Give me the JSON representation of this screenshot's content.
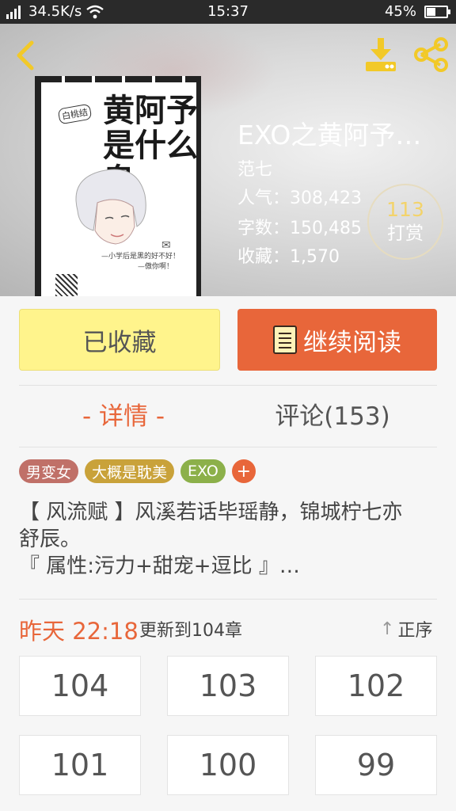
{
  "status_bar": {
    "network_speed": "34.5K/s",
    "time": "15:37",
    "battery": "45%",
    "battery_level": 0.45
  },
  "book": {
    "title": "EXO之黄阿予…",
    "author": "范七",
    "popularity": "人气：308,423",
    "word_count": "字数：150,485",
    "favorites": "收藏：1,570",
    "tip_count": "113",
    "tip_label": "打赏",
    "cover": {
      "title_line1": "黄阿予",
      "title_line2": "是什么鬼",
      "tag": "白桃结",
      "quote_line1": "—小学后是黑的好不好！",
      "quote_line2": "—傲你啊！"
    }
  },
  "actions": {
    "favorite_label": "已收藏",
    "read_label": "继续阅读"
  },
  "tabs": {
    "detail": "- 详情 -",
    "comments": "评论(153)"
  },
  "tags": [
    {
      "label": "男变女",
      "color": "#c07068"
    },
    {
      "label": "大概是耽美",
      "color": "#c9a23a"
    },
    {
      "label": "EXO",
      "color": "#8cb04a"
    }
  ],
  "tag_add": "+",
  "summary": {
    "line1": "【 风流赋 】风溪若话毕瑶静，锦城柠七亦",
    "line2": "舒辰。",
    "line3": "『 属性:污力+甜宠+逗比 』…"
  },
  "update": {
    "time": "昨天 22:18",
    "text": "更新到104章",
    "sort_label": "正序"
  },
  "chapters": [
    "104",
    "103",
    "102",
    "101",
    "100",
    "99"
  ],
  "colors": {
    "accent": "#e8663a",
    "favorite_button": "#fff48c",
    "icon_yellow": "#f2c928"
  }
}
